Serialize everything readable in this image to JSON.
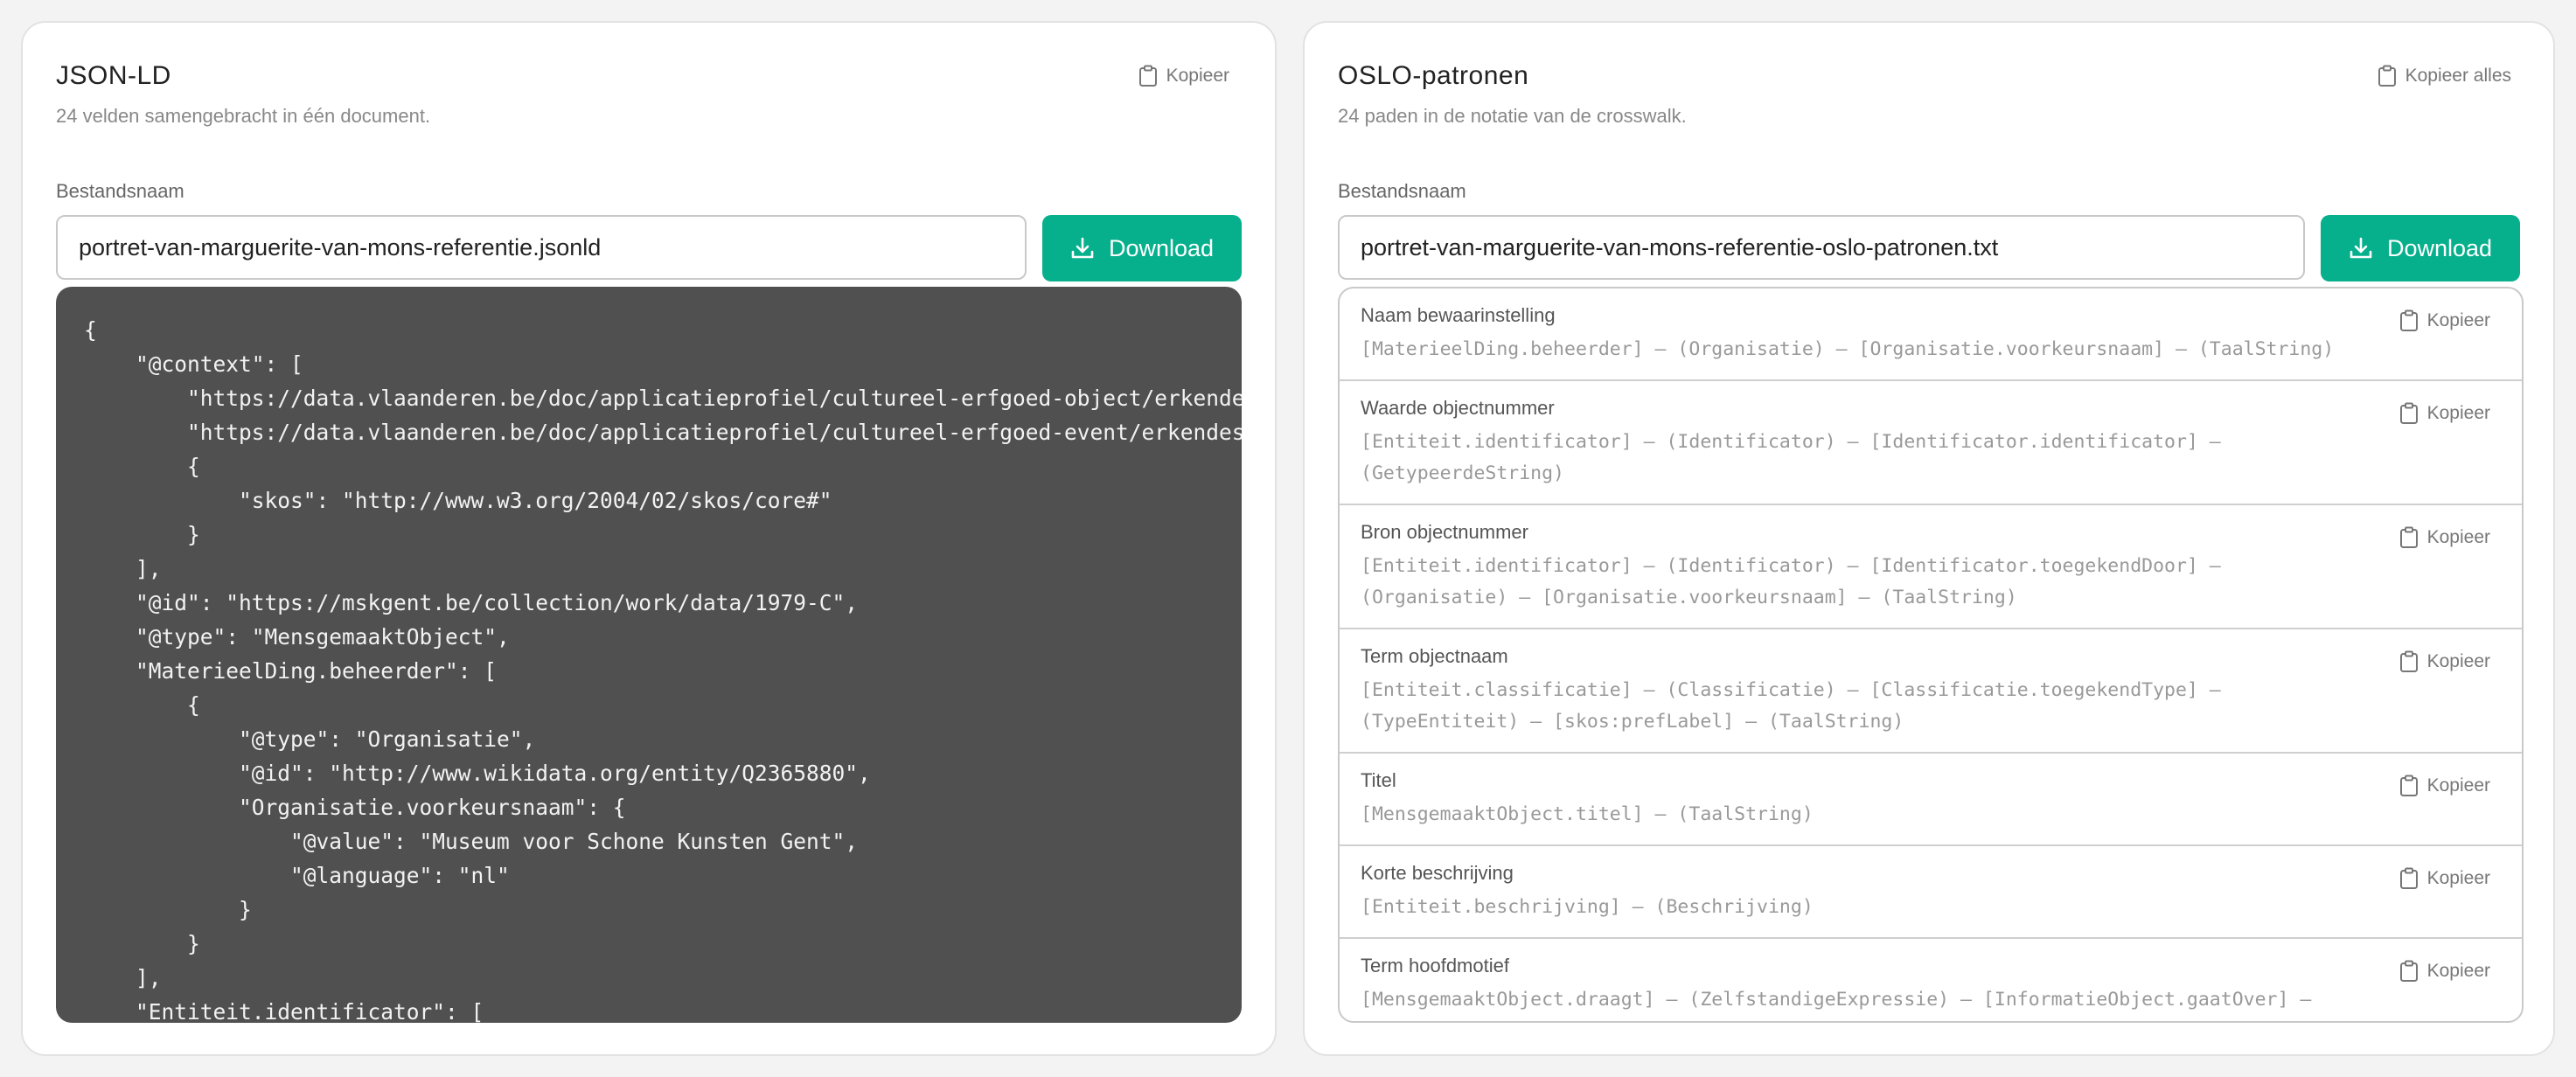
{
  "left_panel": {
    "title": "JSON-LD",
    "subtitle": "24 velden samengebracht in één document.",
    "copy_label": "Kopieer",
    "filename_label": "Bestandsnaam",
    "filename_value": "portret-van-marguerite-van-mons-referentie.jsonld",
    "download_label": "Download",
    "code": "{\n    \"@context\": [\n        \"https://data.vlaanderen.be/doc/applicatieprofiel/cultureel-erfgoed-object/erkendestandaard/2021-04-22/context/cultureel-erfgoed-object-ap.jsonld\",\n        \"https://data.vlaanderen.be/doc/applicatieprofiel/cultureel-erfgoed-event/erkendestandaard/2021-04-22/context/cultureel-erfgoed-event-ap.jsonld\",\n        {\n            \"skos\": \"http://www.w3.org/2004/02/skos/core#\"\n        }\n    ],\n    \"@id\": \"https://mskgent.be/collection/work/data/1979-C\",\n    \"@type\": \"MensgemaaktObject\",\n    \"MaterieelDing.beheerder\": [\n        {\n            \"@type\": \"Organisatie\",\n            \"@id\": \"http://www.wikidata.org/entity/Q2365880\",\n            \"Organisatie.voorkeursnaam\": {\n                \"@value\": \"Museum voor Schone Kunsten Gent\",\n                \"@language\": \"nl\"\n            }\n        }\n    ],\n    \"Entiteit.identificator\": ["
  },
  "right_panel": {
    "title": "OSLO-patronen",
    "subtitle": "24 paden in de notatie van de crosswalk.",
    "copy_all_label": "Kopieer alles",
    "filename_label": "Bestandsnaam",
    "filename_value": "portret-van-marguerite-van-mons-referentie-oslo-patronen.txt",
    "download_label": "Download",
    "item_copy_label": "Kopieer",
    "patterns": [
      {
        "name": "Naam bewaarinstelling",
        "path": "[MaterieelDing.beheerder] – (Organisatie) – [Organisatie.voorkeursnaam] – (TaalString)"
      },
      {
        "name": "Waarde objectnummer",
        "path": "[Entiteit.identificator] – (Identificator) – [Identificator.identificator] – (GetypeerdeString)"
      },
      {
        "name": "Bron objectnummer",
        "path": "[Entiteit.identificator] – (Identificator) – [Identificator.toegekendDoor] – (Organisatie) – [Organisatie.voorkeursnaam] – (TaalString)"
      },
      {
        "name": "Term objectnaam",
        "path": "[Entiteit.classificatie] – (Classificatie) – [Classificatie.toegekendType] – (TypeEntiteit) – [skos:prefLabel] – (TaalString)"
      },
      {
        "name": "Titel",
        "path": "[MensgemaaktObject.titel] – (TaalString)"
      },
      {
        "name": "Korte beschrijving",
        "path": "[Entiteit.beschrijving] – (Beschrijving)"
      },
      {
        "name": "Term hoofdmotief",
        "path": "[MensgemaaktObject.draagt] – (ZelfstandigeExpressie) – [InformatieObject.gaatOver] – (Entiteit) – [skos:prefLabel] – (TaalString)"
      }
    ]
  },
  "colors": {
    "accent": "#06b08c",
    "code_background": "#505050"
  },
  "icons": [
    "clipboard-icon",
    "download-icon"
  ]
}
